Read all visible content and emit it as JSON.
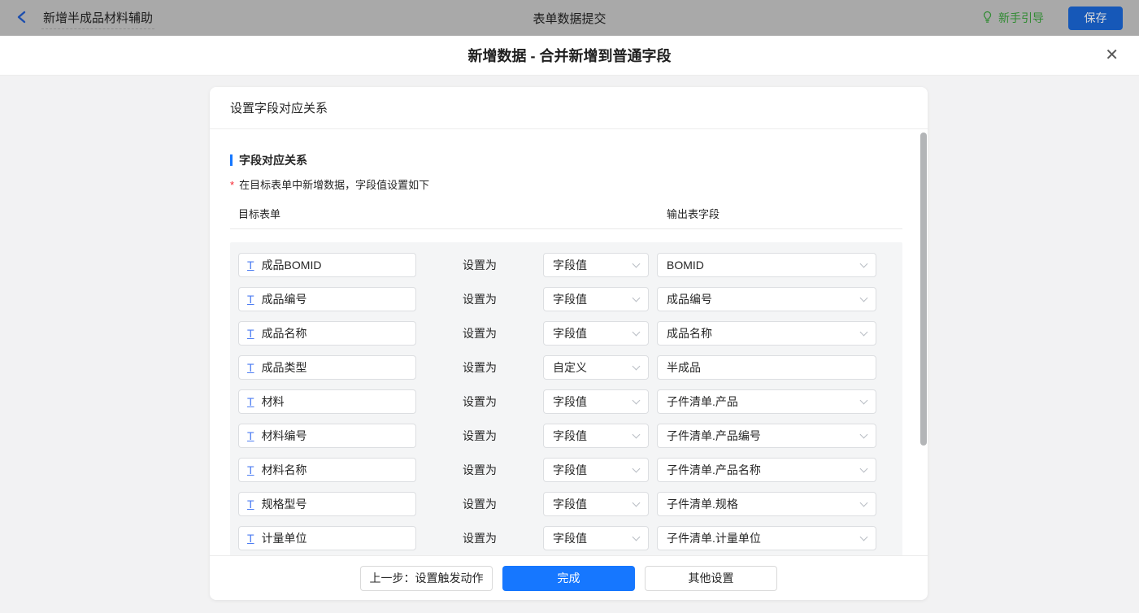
{
  "nav": {
    "title": "新增半成品材料辅助",
    "center_title": "表单数据提交",
    "guide_label": "新手引导",
    "save_label": "保存"
  },
  "dialog": {
    "title": "新增数据 - 合并新增到普通字段",
    "close_glyph": "✕"
  },
  "panel": {
    "header": "设置字段对应关系",
    "section_title": "字段对应关系",
    "required_marker": "*",
    "note": "在目标表单中新增数据，字段值设置如下",
    "columns": {
      "target": "目标表单",
      "output": "输出表字段"
    },
    "set_as_label": "设置为"
  },
  "rows": [
    {
      "target": "成品BOMID",
      "mode": "字段值",
      "value": "BOMID",
      "value_is_select": true
    },
    {
      "target": "成品编号",
      "mode": "字段值",
      "value": "成品编号",
      "value_is_select": true
    },
    {
      "target": "成品名称",
      "mode": "字段值",
      "value": "成品名称",
      "value_is_select": true
    },
    {
      "target": "成品类型",
      "mode": "自定义",
      "value": "半成品",
      "value_is_select": false
    },
    {
      "target": "材料",
      "mode": "字段值",
      "value": "子件清单.产品",
      "value_is_select": true
    },
    {
      "target": "材料编号",
      "mode": "字段值",
      "value": "子件清单.产品编号",
      "value_is_select": true
    },
    {
      "target": "材料名称",
      "mode": "字段值",
      "value": "子件清单.产品名称",
      "value_is_select": true
    },
    {
      "target": "规格型号",
      "mode": "字段值",
      "value": "子件清单.规格",
      "value_is_select": true
    },
    {
      "target": "计量单位",
      "mode": "字段值",
      "value": "子件清单.计量单位",
      "value_is_select": true
    }
  ],
  "rows_overflow_partial": true,
  "footer": {
    "prev_label": "上一步：设置触发动作",
    "done_label": "完成",
    "other_label": "其他设置"
  },
  "icons": {
    "back": "chevron-left-icon",
    "guide": "lightbulb-icon",
    "close": "close-icon",
    "field_type": "text-field-icon",
    "dropdown": "chevron-down-icon"
  },
  "colors": {
    "accent_blue": "#1677ff",
    "dimmed_save_blue": "#1658b8",
    "guide_green": "#318b33",
    "required_red": "#f5222d",
    "nav_bg": "#a9a9a9",
    "page_bg": "#f2f2f3",
    "rows_bg": "#f4f5f6",
    "scroll_thumb": "#b3b5b7"
  }
}
